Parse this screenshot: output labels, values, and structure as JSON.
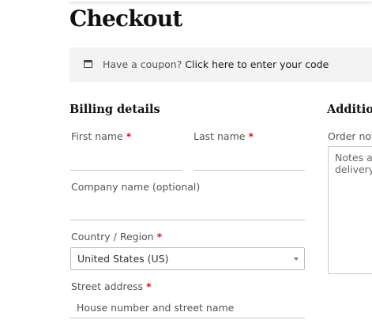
{
  "page": {
    "title": "Checkout"
  },
  "coupon": {
    "prompt": "Have a coupon?",
    "link": "Click here to enter your code",
    "icon": "coupon-icon"
  },
  "billing": {
    "heading": "Billing details",
    "first_name": {
      "label": "First name",
      "required_mark": "*",
      "value": ""
    },
    "last_name": {
      "label": "Last name",
      "required_mark": "*",
      "value": ""
    },
    "company": {
      "label": "Company name (optional)",
      "value": ""
    },
    "country": {
      "label": "Country / Region",
      "required_mark": "*",
      "selected": "United States (US)"
    },
    "street": {
      "label": "Street address",
      "required_mark": "*",
      "placeholder": "House number and street name"
    }
  },
  "additional": {
    "heading": "Additio",
    "order_notes": {
      "label": "Order not",
      "placeholder": "Notes al\ndelivery"
    }
  },
  "colors": {
    "required": "#d3141b",
    "coupon_bar": "#f3f3f3",
    "heading": "#111111"
  }
}
